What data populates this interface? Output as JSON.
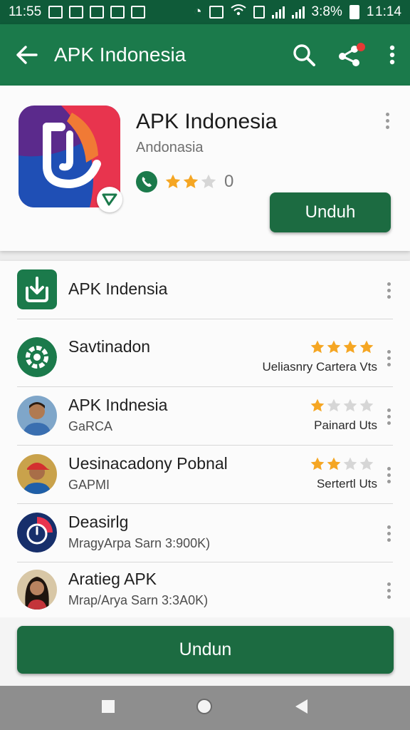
{
  "status_bar": {
    "time": "11:55",
    "battery": "3:8%",
    "clock_right": "1 1:14"
  },
  "toolbar": {
    "title": "APK Indonesia",
    "icons": [
      "back-arrow-icon",
      "search-icon",
      "share-icon",
      "more-vert-icon"
    ],
    "accent": "#1b7a4b"
  },
  "app": {
    "name": "APK Indonesia",
    "developer": "Andonasia",
    "rating_count": "0",
    "rating_stars": 2,
    "install_label": "Unduh"
  },
  "list": [
    {
      "title": "APK Indensia",
      "subtitle": "",
      "meta": "",
      "stars": null,
      "avatar": "download-app-icon"
    },
    {
      "title": "Savtinadon",
      "subtitle": "",
      "meta": "Ueliasnry Cartera Vts",
      "stars": 4,
      "avatar": "settings-app-icon"
    },
    {
      "title": "APK Indnesia",
      "subtitle": "GaRCA",
      "meta": "Painard Uts",
      "stars": 1,
      "avatar": "user-photo"
    },
    {
      "title": "Uesinacadony Pobnal",
      "subtitle": "GAPMI",
      "meta": "Sertertl Uts",
      "stars": 2,
      "avatar": "user-photo-red-cap"
    },
    {
      "title": "Deasirlg",
      "subtitle": "MragyArpa Sarn 3:900K)",
      "meta": "",
      "stars": null,
      "avatar": "clock-app-icon"
    },
    {
      "title": "Aratieg APK",
      "subtitle": "Mrap/Arya Sarn 3:3A0K)",
      "meta": "",
      "stars": null,
      "avatar": "user-photo-woman"
    }
  ],
  "bottom_button": {
    "label": "Undun"
  },
  "colors": {
    "primary": "#1c6b41",
    "star": "#f5a623",
    "star_empty": "#d6d6d6"
  }
}
